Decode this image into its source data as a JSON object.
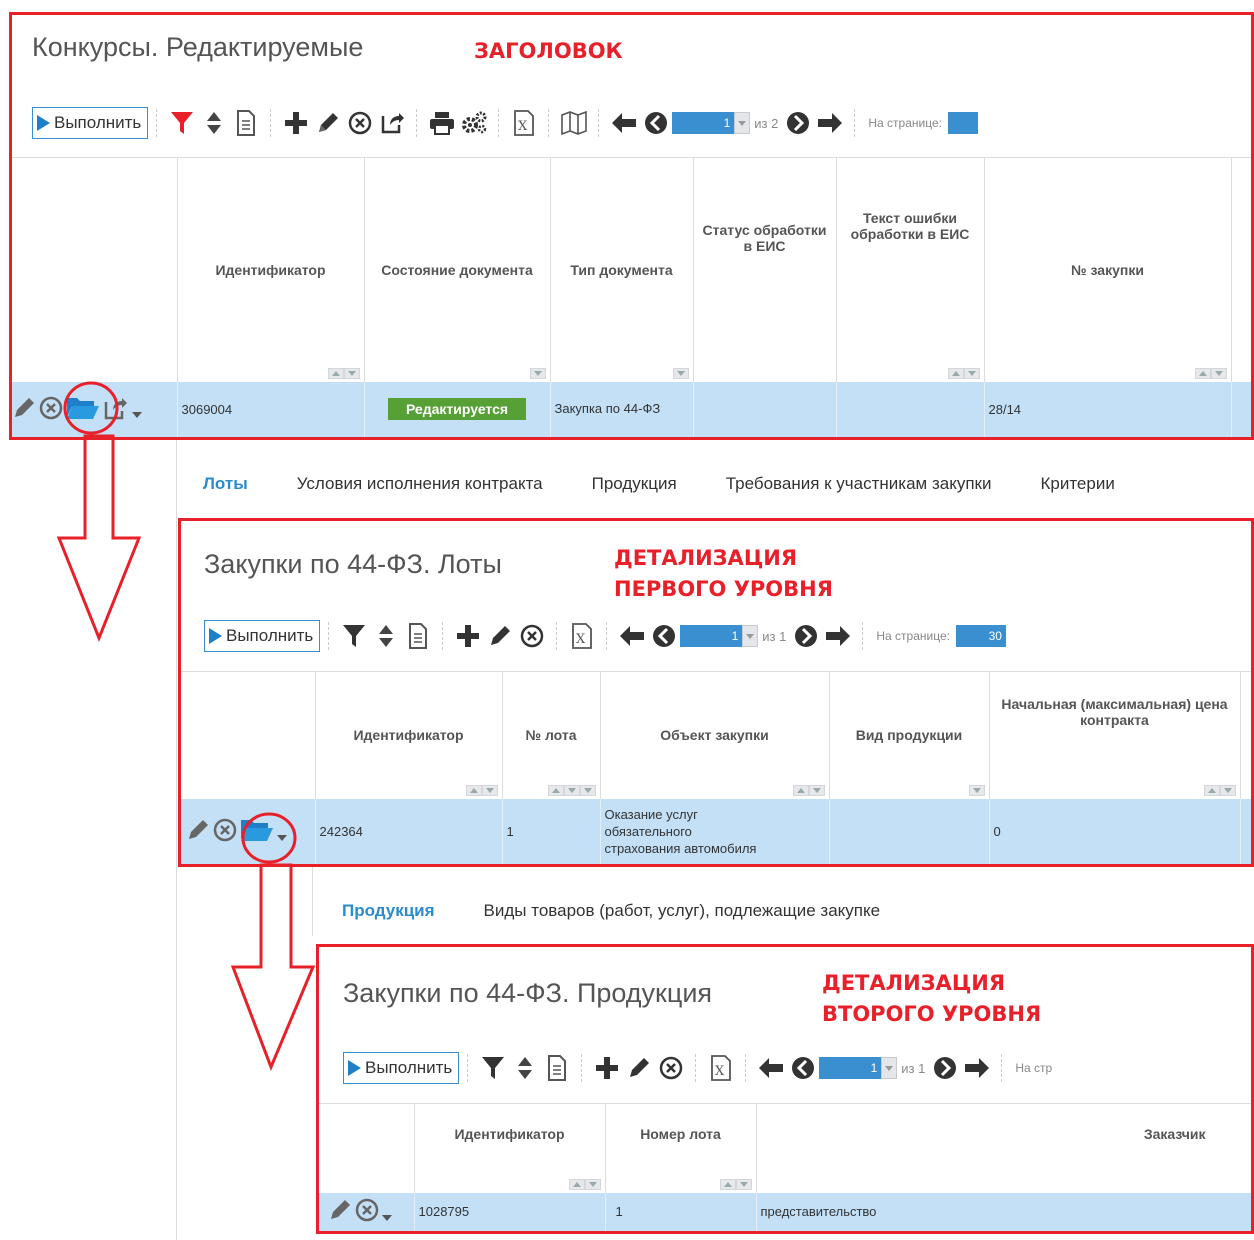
{
  "colors": {
    "accent": "#2a8ccc",
    "annotation": "#e8202a",
    "row_selected": "#c3e0f7",
    "status_green": "#56a035",
    "filter_active": "#e8202a"
  },
  "level0": {
    "title": "Конкурсы. Редактируемые",
    "annotation": [
      "ЗАГОЛОВОК"
    ],
    "toolbar": {
      "run_label": "Выполнить",
      "page_current": "1",
      "page_of": "из 2",
      "per_page_label": "На странице:",
      "per_page_value": "",
      "icons": [
        "filter-icon",
        "sort-icon",
        "document-icon",
        "add-icon",
        "edit-icon",
        "delete-icon",
        "export-icon",
        "print-icon",
        "settings-icon",
        "excel-icon",
        "map-icon",
        "arrow-left-icon",
        "prev-page-icon",
        "next-page-icon",
        "arrow-right-icon"
      ]
    },
    "columns": [
      "Идентификатор",
      "Состояние документа",
      "Тип документа",
      "Статус обработки в ЕИС",
      "Текст ошибки обработки в ЕИС",
      "№ закупки"
    ],
    "row": {
      "id": "3069004",
      "state": "Редактируется",
      "type": "Закупка по 44-ФЗ",
      "eis_status": "",
      "eis_error": "",
      "purchase_no": "28/14"
    },
    "row_icons": [
      "edit-icon",
      "delete-icon",
      "open-folder-icon",
      "share-icon",
      "dropdown-icon"
    ]
  },
  "tabs1": {
    "items": [
      "Лоты",
      "Условия исполнения контракта",
      "Продукция",
      "Требования к участникам закупки",
      "Критерии"
    ],
    "active": 0
  },
  "level1": {
    "title": "Закупки по 44-ФЗ. Лоты",
    "annotation": [
      "ДЕТАЛИЗАЦИЯ",
      "ПЕРВОГО УРОВНЯ"
    ],
    "toolbar": {
      "run_label": "Выполнить",
      "page_current": "1",
      "page_of": "из 1",
      "per_page_label": "На странице:",
      "per_page_value": "30"
    },
    "columns": [
      "Идентификатор",
      "№ лота",
      "Объект закупки",
      "Вид продукции",
      "Начальная (максимальная) цена контракта"
    ],
    "row": {
      "id": "242364",
      "lot_no": "1",
      "object_line1": "Оказание услуг",
      "object_line2": "обязательного",
      "object_line3": "страхования автомобиля",
      "product_kind": "",
      "price": "0"
    }
  },
  "tabs2": {
    "items": [
      "Продукция",
      "Виды товаров (работ, услуг), подлежащие закупке"
    ],
    "active": 0
  },
  "level2": {
    "title": "Закупки по 44-ФЗ. Продукция",
    "annotation": [
      "ДЕТАЛИЗАЦИЯ",
      "ВТОРОГО УРОВНЯ"
    ],
    "toolbar": {
      "run_label": "Выполнить",
      "page_current": "1",
      "page_of": "из 1",
      "per_page_label": "На стр"
    },
    "columns": [
      "Идентификатор",
      "Номер лота",
      "Заказчик"
    ],
    "row": {
      "id": "1028795",
      "lot_no": "1",
      "customer": "представительство"
    }
  }
}
